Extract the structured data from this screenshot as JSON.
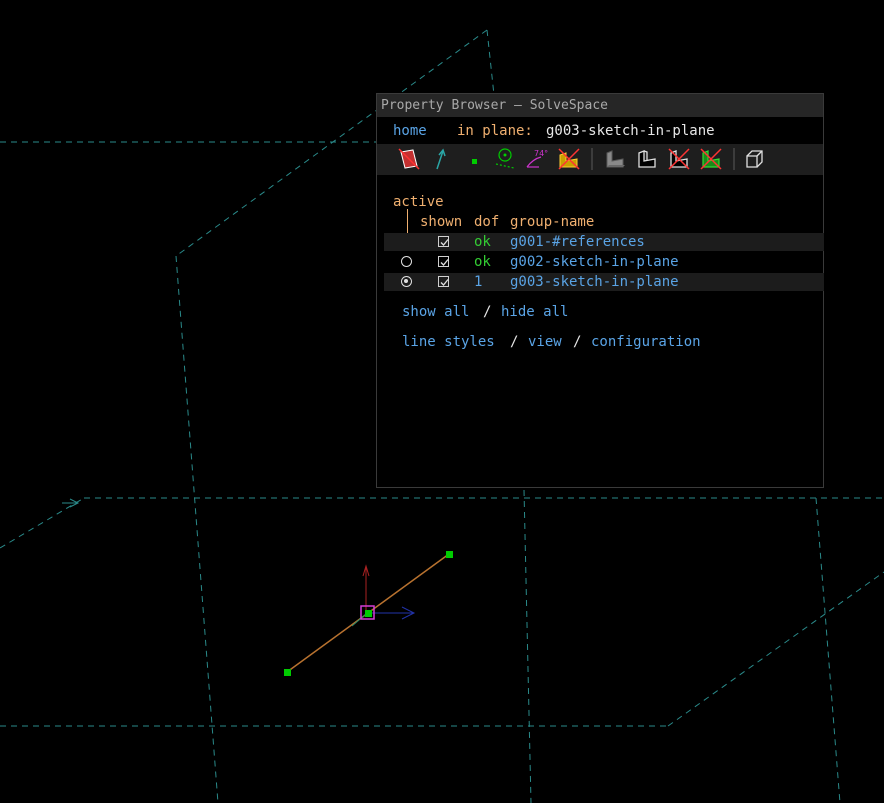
{
  "window": {
    "title": "Property Browser — SolveSpace"
  },
  "nav": {
    "home": "home",
    "in_plane_label": "in plane:",
    "in_plane_value": "g003-sketch-in-plane"
  },
  "toolbar": {
    "icons": [
      "workplanes-icon",
      "normals-icon",
      "points-icon",
      "construction-icon",
      "constraints-icon",
      "faces-icon",
      "shaded-icon",
      "edges-icon",
      "outline-icon",
      "hidden-lines-icon",
      "mesh-icon",
      "perspective-icon"
    ]
  },
  "groups": {
    "active_label": "active",
    "headers": {
      "shown": "shown",
      "dof": "dof",
      "name": "group-name"
    },
    "rows": [
      {
        "active": "none",
        "shown": true,
        "dof": "ok",
        "name": "g001-#references"
      },
      {
        "active": "off",
        "shown": true,
        "dof": "ok",
        "name": "g002-sketch-in-plane"
      },
      {
        "active": "on",
        "shown": true,
        "dof": "1",
        "name": "g003-sketch-in-plane"
      }
    ]
  },
  "links": {
    "show_all": "show all",
    "slash": "/",
    "hide_all": "hide all",
    "line_styles": "line styles",
    "view": "view",
    "configuration": "configuration"
  },
  "colors": {
    "background": "#000000",
    "workplane_dashed": "#2a8a8a",
    "sketch_line": "#b8722f",
    "point": "#00cc00",
    "link": "#5aa4e6",
    "label": "#f0b070",
    "ok": "#33cc33"
  }
}
